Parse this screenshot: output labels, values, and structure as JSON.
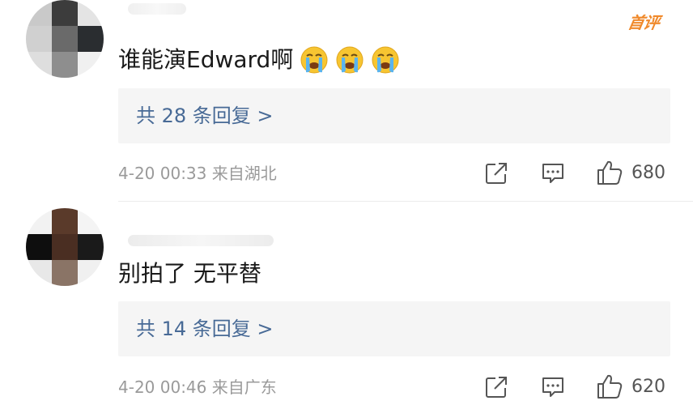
{
  "comments": [
    {
      "badge": "首评",
      "text": "谁能演Edward啊",
      "emojis": [
        "crying-face-emoji",
        "crying-face-emoji",
        "crying-face-emoji"
      ],
      "reply_label": "共 28 条回复 >",
      "timestamp": "4-20 00:33",
      "location": "来自湖北",
      "likes": "680"
    },
    {
      "text": "别拍了 无平替",
      "reply_label": "共 14 条回复 >",
      "timestamp": "4-20 00:46",
      "location": "来自广东",
      "likes": "620"
    }
  ],
  "icons": {
    "share": "share-icon",
    "comment": "comment-icon",
    "like": "thumbs-up-icon"
  },
  "colors": {
    "badge": "#f08a2c",
    "reply_link": "#486a96",
    "meta_text": "#9a9a9a",
    "reply_bg": "#f5f5f5"
  }
}
